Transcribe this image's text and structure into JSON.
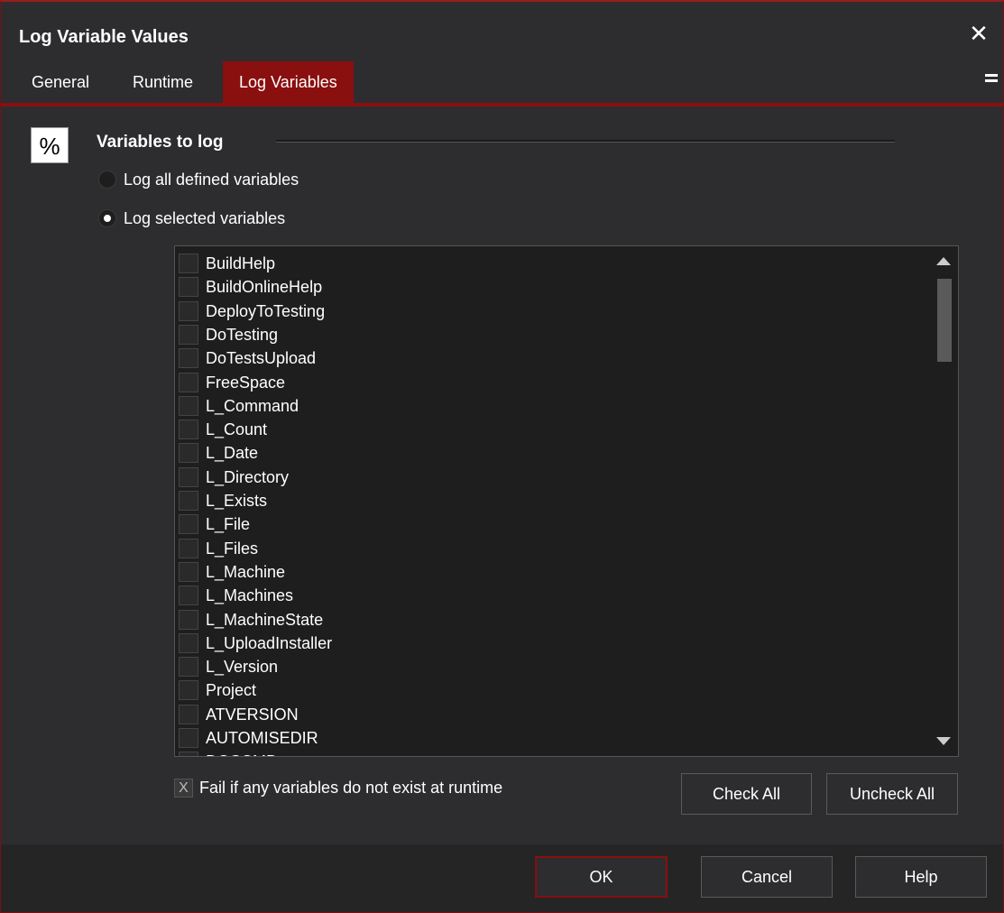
{
  "window": {
    "title": "Log Variable Values",
    "close_glyph": "✕"
  },
  "tabs": [
    {
      "label": "General",
      "active": false
    },
    {
      "label": "Runtime",
      "active": false
    },
    {
      "label": "Log Variables",
      "active": true
    }
  ],
  "section": {
    "icon_text": "%",
    "label": "Variables to log"
  },
  "radios": [
    {
      "label": "Log all defined variables",
      "checked": false
    },
    {
      "label": "Log selected variables",
      "checked": true
    }
  ],
  "variables": [
    "BuildHelp",
    "BuildOnlineHelp",
    "DeployToTesting",
    "DoTesting",
    "DoTestsUpload",
    "FreeSpace",
    "L_Command",
    "L_Count",
    "L_Date",
    "L_Directory",
    "L_Exists",
    "L_File",
    "L_Files",
    "L_Machine",
    "L_Machines",
    "L_MachineState",
    "L_UploadInstaller",
    "L_Version",
    "Project",
    "ATVERSION",
    "AUTOMISEDIR",
    "DOSCMD"
  ],
  "fail_option": {
    "label": "Fail if any variables do not exist at runtime",
    "checked": true,
    "check_glyph": "X"
  },
  "list_buttons": {
    "check_all": "Check All",
    "uncheck_all": "Uncheck All"
  },
  "footer_buttons": {
    "ok": "OK",
    "cancel": "Cancel",
    "help": "Help"
  },
  "colors": {
    "accent": "#8a0f0f",
    "background": "#2d2d30",
    "list_background": "#1e1e1e"
  }
}
